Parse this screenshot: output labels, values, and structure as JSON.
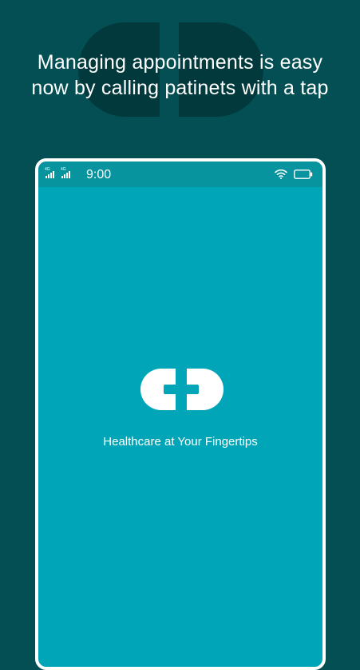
{
  "headline": {
    "line1": "Managing appointments is easy",
    "line2": "now by calling patinets with a tap"
  },
  "status_bar": {
    "time": "9:00",
    "network_label_1": "4G",
    "network_label_2": "4G",
    "icons": [
      "signal-4g-icon",
      "signal-4g-icon",
      "wifi-icon",
      "battery-icon"
    ]
  },
  "splash": {
    "logo": "healthcare-capsule-cross-logo",
    "tagline": "Healthcare at Your Fingertips"
  },
  "colors": {
    "background": "#034f53",
    "phone_screen": "#00a6b7",
    "status_bar": "#07949f",
    "text": "#ffffff",
    "background_logo": "#02393c"
  }
}
